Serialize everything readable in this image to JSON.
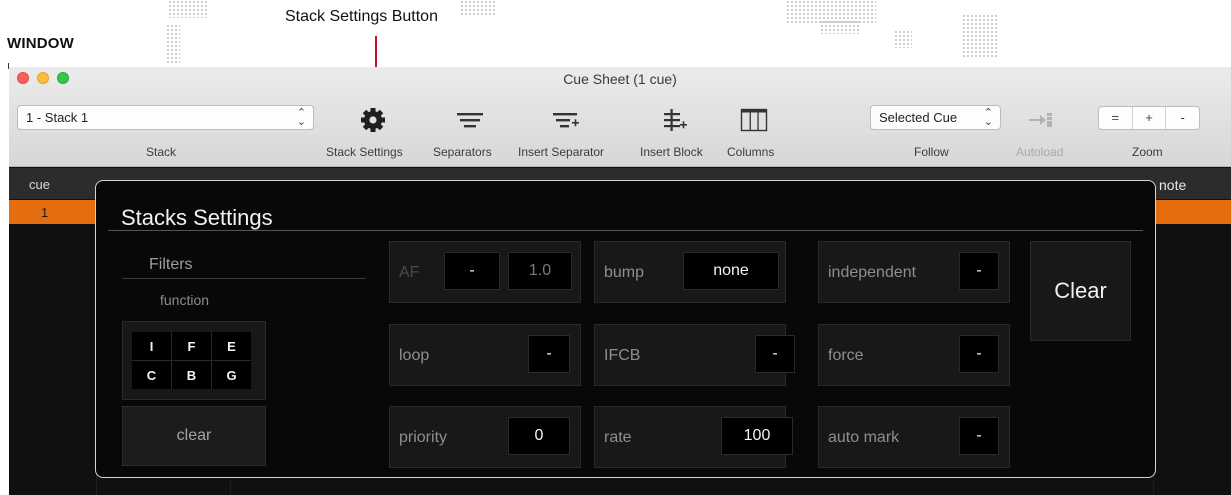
{
  "annotations": {
    "window_label": "WINDOW",
    "stack_settings_label": "Stack Settings Button",
    "callout_color": "#c8102e"
  },
  "window": {
    "title": "Cue Sheet (1 cue)"
  },
  "toolbar": {
    "stack_select_value": "1 - Stack 1",
    "stack_label": "Stack",
    "stack_settings_label": "Stack Settings",
    "separators_label": "Separators",
    "insert_separator_label": "Insert Separator",
    "insert_block_label": "Insert Block",
    "columns_label": "Columns",
    "follow_select_value": "Selected Cue",
    "follow_label": "Follow",
    "autoload_label": "Autoload",
    "zoom_label": "Zoom",
    "zoom_buttons": [
      "=",
      "+",
      "-"
    ]
  },
  "cue_table": {
    "columns": {
      "cue": "cue",
      "note": "note"
    },
    "rows": [
      {
        "cue": "1"
      }
    ],
    "selected_row_color": "#e46d10"
  },
  "stacks_settings": {
    "title": "Stacks Settings",
    "filters_label": "Filters",
    "function_label": "function",
    "function_filters": [
      "I",
      "F",
      "E",
      "C",
      "B",
      "G"
    ],
    "clear_filters_label": "clear",
    "af": {
      "label": "AF",
      "mode": "-",
      "value": "1.0"
    },
    "bump": {
      "label": "bump",
      "value": "none"
    },
    "independent": {
      "label": "independent",
      "value": "-"
    },
    "loop": {
      "label": "loop",
      "value": "-"
    },
    "ifcb": {
      "label": "IFCB",
      "value": "-"
    },
    "force": {
      "label": "force",
      "value": "-"
    },
    "priority": {
      "label": "priority",
      "value": "0"
    },
    "rate": {
      "label": "rate",
      "value": "100"
    },
    "auto_mark": {
      "label": "auto mark",
      "value": "-"
    },
    "clear_label": "Clear"
  }
}
